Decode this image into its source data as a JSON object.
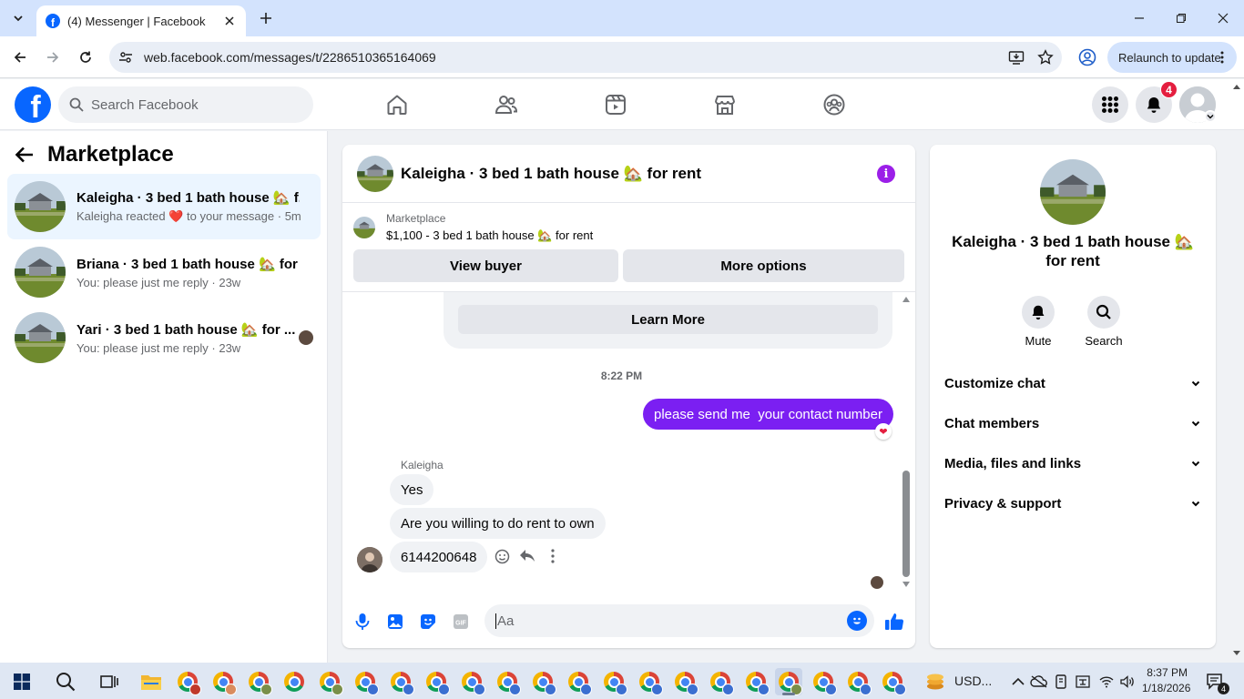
{
  "browser": {
    "tab_title": "(4) Messenger | Facebook",
    "url": "web.facebook.com/messages/t/2286510365164069",
    "relaunch_label": "Relaunch to update"
  },
  "fb_nav": {
    "search_placeholder": "Search Facebook",
    "notification_count": "4"
  },
  "left_panel": {
    "title": "Marketplace",
    "conversations": [
      {
        "name": "Kaleigha · 3 bed 1 bath house 🏡 f...",
        "subtitle_pre": "Kaleigha reacted",
        "subtitle_heart": "❤️",
        "subtitle_post": "to your message",
        "time": "5m",
        "active": true
      },
      {
        "name": "Briana · 3 bed 1 bath house 🏡 for ...",
        "subtitle": "You: please just me reply",
        "time": "23w"
      },
      {
        "name": "Yari · 3 bed 1 bath house 🏡 for ...",
        "subtitle": "You: please just me reply",
        "time": "23w"
      }
    ]
  },
  "chat": {
    "title": "Kaleigha · 3 bed 1 bath house 🏡 for rent",
    "listing_label": "Marketplace",
    "listing_text": "$1,100 - 3 bed 1 bath house 🏡 for rent",
    "view_buyer": "View buyer",
    "more_options": "More options",
    "learn_more": "Learn More",
    "timestamp": "8:22 PM",
    "outgoing": "please send me  your contact number",
    "reaction": "❤",
    "sender_name": "Kaleigha",
    "incoming": [
      "Yes",
      "Are you willing to do rent to own",
      "6144200648"
    ],
    "composer_placeholder": "Aa"
  },
  "info_panel": {
    "title": "Kaleigha · 3 bed 1 bath house 🏡 for rent",
    "mute_label": "Mute",
    "search_label": "Search",
    "sections": [
      "Customize chat",
      "Chat members",
      "Media, files and links",
      "Privacy & support"
    ]
  },
  "taskbar": {
    "weather": "USD...",
    "time": "8:37 PM",
    "date": "1/18/2026",
    "notification_count": "4"
  }
}
